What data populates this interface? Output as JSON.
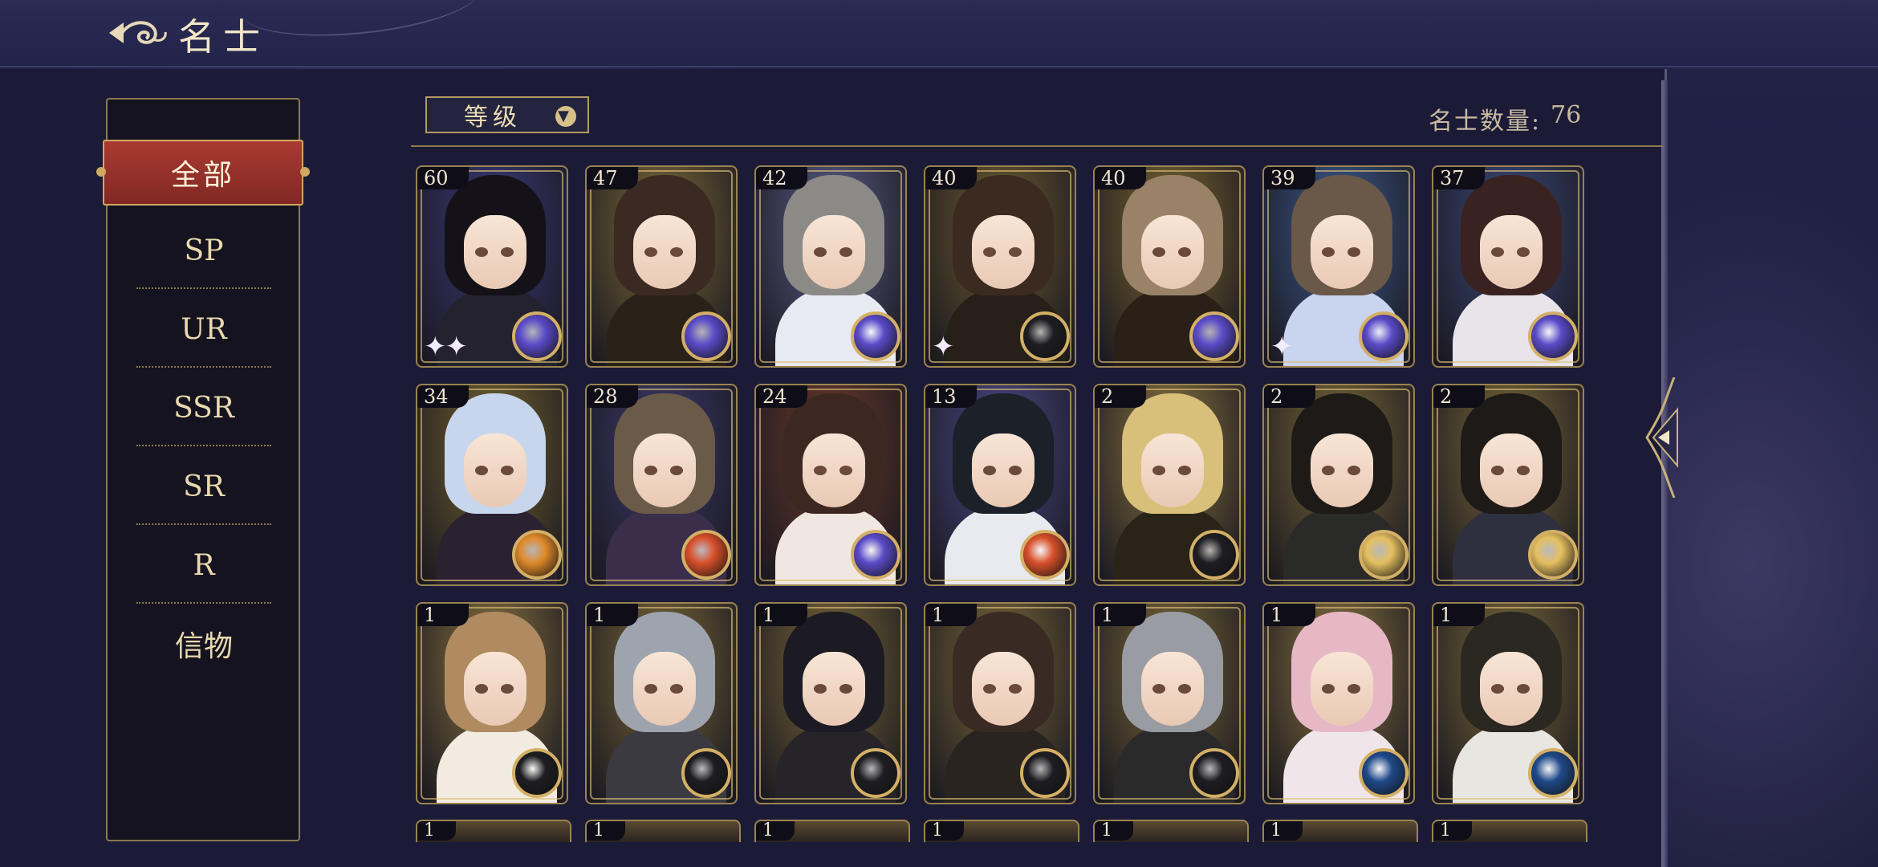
{
  "header": {
    "title": "名士"
  },
  "sidebar": {
    "items": [
      {
        "label": "全部",
        "active": true
      },
      {
        "label": "SP"
      },
      {
        "label": "UR"
      },
      {
        "label": "SSR"
      },
      {
        "label": "SR"
      },
      {
        "label": "R"
      },
      {
        "label": "信物"
      }
    ]
  },
  "filter": {
    "label": "等级"
  },
  "count": {
    "label": "名士数量:",
    "value": "76"
  },
  "cards": [
    {
      "level": "60",
      "bg": "#3b3a78",
      "hair": "#141218",
      "body": "#23222e",
      "badge": "purple",
      "stars": "✦✦"
    },
    {
      "level": "47",
      "bg": "#7c6a38",
      "hair": "#3b2a22",
      "body": "#2a2218",
      "badge": "purple",
      "stars": ""
    },
    {
      "level": "42",
      "bg": "#5a5d88",
      "hair": "#8c8a86",
      "body": "#e8eaf2",
      "badge": "purple",
      "stars": ""
    },
    {
      "level": "40",
      "bg": "#6e5c30",
      "hair": "#3a2a20",
      "body": "#262018",
      "badge": "dark",
      "stars": "✦"
    },
    {
      "level": "40",
      "bg": "#7a6630",
      "hair": "#9a8268",
      "body": "#2a2018",
      "badge": "purple",
      "stars": ""
    },
    {
      "level": "39",
      "bg": "#3c5a8c",
      "hair": "#6a5848",
      "body": "#c9d4ef",
      "badge": "purple",
      "stars": "✦"
    },
    {
      "level": "37",
      "bg": "#3a4a7a",
      "hair": "#3a2220",
      "body": "#e8e4ea",
      "badge": "purple",
      "stars": ""
    },
    {
      "level": "34",
      "bg": "#756430",
      "hair": "#c7d6ec",
      "body": "#2a2230",
      "badge": "orange",
      "stars": ""
    },
    {
      "level": "28",
      "bg": "#3c3a6a",
      "hair": "#6a5a48",
      "body": "#3b2e4a",
      "badge": "red",
      "stars": ""
    },
    {
      "level": "24",
      "bg": "#6a3a2a",
      "hair": "#3c2820",
      "body": "#f0e8e0",
      "badge": "purple",
      "stars": ""
    },
    {
      "level": "13",
      "bg": "#4a4a88",
      "hair": "#1c2028",
      "body": "#e8eaf0",
      "badge": "red",
      "stars": ""
    },
    {
      "level": "2",
      "bg": "#8a7440",
      "hair": "#d8c07a",
      "body": "#2a2418",
      "badge": "dark",
      "stars": ""
    },
    {
      "level": "2",
      "bg": "#7a6838",
      "hair": "#1e1a18",
      "body": "#2a2a28",
      "badge": "gold",
      "stars": ""
    },
    {
      "level": "2",
      "bg": "#7a6838",
      "hair": "#1e1a18",
      "body": "#2e3040",
      "badge": "gold",
      "stars": ""
    },
    {
      "level": "1",
      "bg": "#8a7440",
      "hair": "#b08a60",
      "body": "#f2ece0",
      "badge": "dark",
      "stars": ""
    },
    {
      "level": "1",
      "bg": "#7a6838",
      "hair": "#9ea4ae",
      "body": "#3a3a40",
      "badge": "dark",
      "stars": ""
    },
    {
      "level": "1",
      "bg": "#7a6838",
      "hair": "#1c1a22",
      "body": "#262428",
      "badge": "dark",
      "stars": ""
    },
    {
      "level": "1",
      "bg": "#7a6838",
      "hair": "#3a2a24",
      "body": "#2a2420",
      "badge": "dark",
      "stars": ""
    },
    {
      "level": "1",
      "bg": "#7a6838",
      "hair": "#9a9ca4",
      "body": "#2a2a2a",
      "badge": "dark",
      "stars": ""
    },
    {
      "level": "1",
      "bg": "#8a7440",
      "hair": "#e6b8c6",
      "body": "#f0e6ea",
      "badge": "blue",
      "stars": ""
    },
    {
      "level": "1",
      "bg": "#7a6838",
      "hair": "#2a2820",
      "body": "#e8e6e0",
      "badge": "blue",
      "stars": ""
    }
  ],
  "partial_row": [
    "1",
    "1",
    "1",
    "1",
    "1",
    "1",
    "1"
  ],
  "badge_colors": {
    "purple": "#5a4bc8",
    "dark": "#1e1d22",
    "orange": "#e08a2a",
    "red": "#d8502a",
    "gold": "#e6c060",
    "blue": "#1f4a8a"
  }
}
